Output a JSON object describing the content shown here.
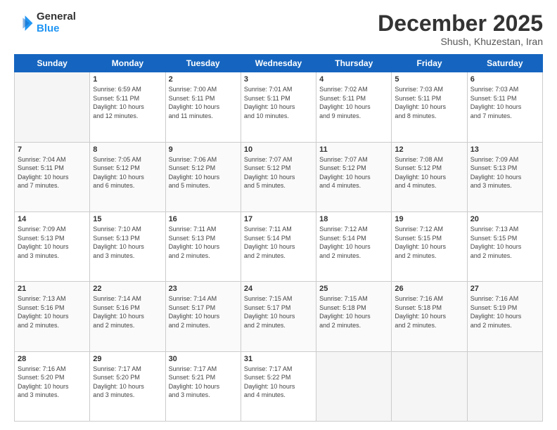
{
  "header": {
    "logo": {
      "general": "General",
      "blue": "Blue"
    },
    "title": "December 2025",
    "subtitle": "Shush, Khuzestan, Iran"
  },
  "calendar": {
    "days": [
      "Sunday",
      "Monday",
      "Tuesday",
      "Wednesday",
      "Thursday",
      "Friday",
      "Saturday"
    ],
    "rows": [
      [
        {
          "day": "",
          "empty": true
        },
        {
          "day": "1",
          "line1": "Sunrise: 6:59 AM",
          "line2": "Sunset: 5:11 PM",
          "line3": "Daylight: 10 hours",
          "line4": "and 12 minutes."
        },
        {
          "day": "2",
          "line1": "Sunrise: 7:00 AM",
          "line2": "Sunset: 5:11 PM",
          "line3": "Daylight: 10 hours",
          "line4": "and 11 minutes."
        },
        {
          "day": "3",
          "line1": "Sunrise: 7:01 AM",
          "line2": "Sunset: 5:11 PM",
          "line3": "Daylight: 10 hours",
          "line4": "and 10 minutes."
        },
        {
          "day": "4",
          "line1": "Sunrise: 7:02 AM",
          "line2": "Sunset: 5:11 PM",
          "line3": "Daylight: 10 hours",
          "line4": "and 9 minutes."
        },
        {
          "day": "5",
          "line1": "Sunrise: 7:03 AM",
          "line2": "Sunset: 5:11 PM",
          "line3": "Daylight: 10 hours",
          "line4": "and 8 minutes."
        },
        {
          "day": "6",
          "line1": "Sunrise: 7:03 AM",
          "line2": "Sunset: 5:11 PM",
          "line3": "Daylight: 10 hours",
          "line4": "and 7 minutes."
        }
      ],
      [
        {
          "day": "7",
          "line1": "Sunrise: 7:04 AM",
          "line2": "Sunset: 5:11 PM",
          "line3": "Daylight: 10 hours",
          "line4": "and 7 minutes."
        },
        {
          "day": "8",
          "line1": "Sunrise: 7:05 AM",
          "line2": "Sunset: 5:12 PM",
          "line3": "Daylight: 10 hours",
          "line4": "and 6 minutes."
        },
        {
          "day": "9",
          "line1": "Sunrise: 7:06 AM",
          "line2": "Sunset: 5:12 PM",
          "line3": "Daylight: 10 hours",
          "line4": "and 5 minutes."
        },
        {
          "day": "10",
          "line1": "Sunrise: 7:07 AM",
          "line2": "Sunset: 5:12 PM",
          "line3": "Daylight: 10 hours",
          "line4": "and 5 minutes."
        },
        {
          "day": "11",
          "line1": "Sunrise: 7:07 AM",
          "line2": "Sunset: 5:12 PM",
          "line3": "Daylight: 10 hours",
          "line4": "and 4 minutes."
        },
        {
          "day": "12",
          "line1": "Sunrise: 7:08 AM",
          "line2": "Sunset: 5:12 PM",
          "line3": "Daylight: 10 hours",
          "line4": "and 4 minutes."
        },
        {
          "day": "13",
          "line1": "Sunrise: 7:09 AM",
          "line2": "Sunset: 5:13 PM",
          "line3": "Daylight: 10 hours",
          "line4": "and 3 minutes."
        }
      ],
      [
        {
          "day": "14",
          "line1": "Sunrise: 7:09 AM",
          "line2": "Sunset: 5:13 PM",
          "line3": "Daylight: 10 hours",
          "line4": "and 3 minutes."
        },
        {
          "day": "15",
          "line1": "Sunrise: 7:10 AM",
          "line2": "Sunset: 5:13 PM",
          "line3": "Daylight: 10 hours",
          "line4": "and 3 minutes."
        },
        {
          "day": "16",
          "line1": "Sunrise: 7:11 AM",
          "line2": "Sunset: 5:13 PM",
          "line3": "Daylight: 10 hours",
          "line4": "and 2 minutes."
        },
        {
          "day": "17",
          "line1": "Sunrise: 7:11 AM",
          "line2": "Sunset: 5:14 PM",
          "line3": "Daylight: 10 hours",
          "line4": "and 2 minutes."
        },
        {
          "day": "18",
          "line1": "Sunrise: 7:12 AM",
          "line2": "Sunset: 5:14 PM",
          "line3": "Daylight: 10 hours",
          "line4": "and 2 minutes."
        },
        {
          "day": "19",
          "line1": "Sunrise: 7:12 AM",
          "line2": "Sunset: 5:15 PM",
          "line3": "Daylight: 10 hours",
          "line4": "and 2 minutes."
        },
        {
          "day": "20",
          "line1": "Sunrise: 7:13 AM",
          "line2": "Sunset: 5:15 PM",
          "line3": "Daylight: 10 hours",
          "line4": "and 2 minutes."
        }
      ],
      [
        {
          "day": "21",
          "line1": "Sunrise: 7:13 AM",
          "line2": "Sunset: 5:16 PM",
          "line3": "Daylight: 10 hours",
          "line4": "and 2 minutes."
        },
        {
          "day": "22",
          "line1": "Sunrise: 7:14 AM",
          "line2": "Sunset: 5:16 PM",
          "line3": "Daylight: 10 hours",
          "line4": "and 2 minutes."
        },
        {
          "day": "23",
          "line1": "Sunrise: 7:14 AM",
          "line2": "Sunset: 5:17 PM",
          "line3": "Daylight: 10 hours",
          "line4": "and 2 minutes."
        },
        {
          "day": "24",
          "line1": "Sunrise: 7:15 AM",
          "line2": "Sunset: 5:17 PM",
          "line3": "Daylight: 10 hours",
          "line4": "and 2 minutes."
        },
        {
          "day": "25",
          "line1": "Sunrise: 7:15 AM",
          "line2": "Sunset: 5:18 PM",
          "line3": "Daylight: 10 hours",
          "line4": "and 2 minutes."
        },
        {
          "day": "26",
          "line1": "Sunrise: 7:16 AM",
          "line2": "Sunset: 5:18 PM",
          "line3": "Daylight: 10 hours",
          "line4": "and 2 minutes."
        },
        {
          "day": "27",
          "line1": "Sunrise: 7:16 AM",
          "line2": "Sunset: 5:19 PM",
          "line3": "Daylight: 10 hours",
          "line4": "and 2 minutes."
        }
      ],
      [
        {
          "day": "28",
          "line1": "Sunrise: 7:16 AM",
          "line2": "Sunset: 5:20 PM",
          "line3": "Daylight: 10 hours",
          "line4": "and 3 minutes."
        },
        {
          "day": "29",
          "line1": "Sunrise: 7:17 AM",
          "line2": "Sunset: 5:20 PM",
          "line3": "Daylight: 10 hours",
          "line4": "and 3 minutes."
        },
        {
          "day": "30",
          "line1": "Sunrise: 7:17 AM",
          "line2": "Sunset: 5:21 PM",
          "line3": "Daylight: 10 hours",
          "line4": "and 3 minutes."
        },
        {
          "day": "31",
          "line1": "Sunrise: 7:17 AM",
          "line2": "Sunset: 5:22 PM",
          "line3": "Daylight: 10 hours",
          "line4": "and 4 minutes."
        },
        {
          "day": "",
          "empty": true
        },
        {
          "day": "",
          "empty": true
        },
        {
          "day": "",
          "empty": true
        }
      ]
    ]
  }
}
